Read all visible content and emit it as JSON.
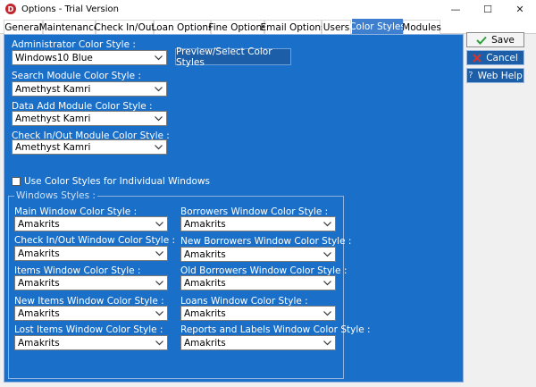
{
  "window": {
    "title": "Options - Trial Version",
    "app_icon_letter": "D",
    "minimize_glyph": "—",
    "maximize_glyph": "☐",
    "close_glyph": "✕"
  },
  "tabs": [
    {
      "label": "General"
    },
    {
      "label": "Maintenance"
    },
    {
      "label": "Check In/Out"
    },
    {
      "label": "Loan Options"
    },
    {
      "label": "Fine Options"
    },
    {
      "label": "Email Options"
    },
    {
      "label": "Users"
    },
    {
      "label": "Color Styles"
    },
    {
      "label": "Modules"
    }
  ],
  "active_tab": "Color Styles",
  "module_styles": {
    "admin": {
      "label": "Administrator Color Style :",
      "value": "Windows10 Blue"
    },
    "search": {
      "label": "Search Module Color Style :",
      "value": "Amethyst Kamri"
    },
    "data_add": {
      "label": "Data Add Module Color Style :",
      "value": "Amethyst Kamri"
    },
    "checkinout": {
      "label": "Check In/Out Module Color Style :",
      "value": "Amethyst Kamri"
    }
  },
  "preview_button": "Preview/Select Color Styles",
  "individual_windows_checkbox": {
    "label": "Use Color Styles for Individual Windows",
    "checked": false
  },
  "windows_styles": {
    "title": "Windows Styles :",
    "left": [
      {
        "label": "Main Window Color Style :",
        "value": "Amakrits"
      },
      {
        "label": "Check In/Out Window Color Style :",
        "value": "Amakrits"
      },
      {
        "label": "Items Window Color Style :",
        "value": "Amakrits"
      },
      {
        "label": "New Items Window Color Style :",
        "value": "Amakrits"
      },
      {
        "label": "Lost Items Window Color Style :",
        "value": "Amakrits"
      }
    ],
    "right": [
      {
        "label": "Borrowers Window Color Style :",
        "value": "Amakrits"
      },
      {
        "label": "New Borrowers Window Color Style :",
        "value": "Amakrits"
      },
      {
        "label": "Old Borrowers Window Color Style :",
        "value": "Amakrits"
      },
      {
        "label": "Loans Window Color Style :",
        "value": "Amakrits"
      },
      {
        "label": "Reports and Labels Window Color Style :",
        "value": "Amakrits"
      }
    ]
  },
  "side_buttons": {
    "save": "Save",
    "cancel": "Cancel",
    "help": "Web Help"
  },
  "colors": {
    "panel": "#1a6fc9",
    "active_tab": "#3f7fcf",
    "save_check": "#2e9e3a",
    "cancel_x": "#d9342b"
  }
}
